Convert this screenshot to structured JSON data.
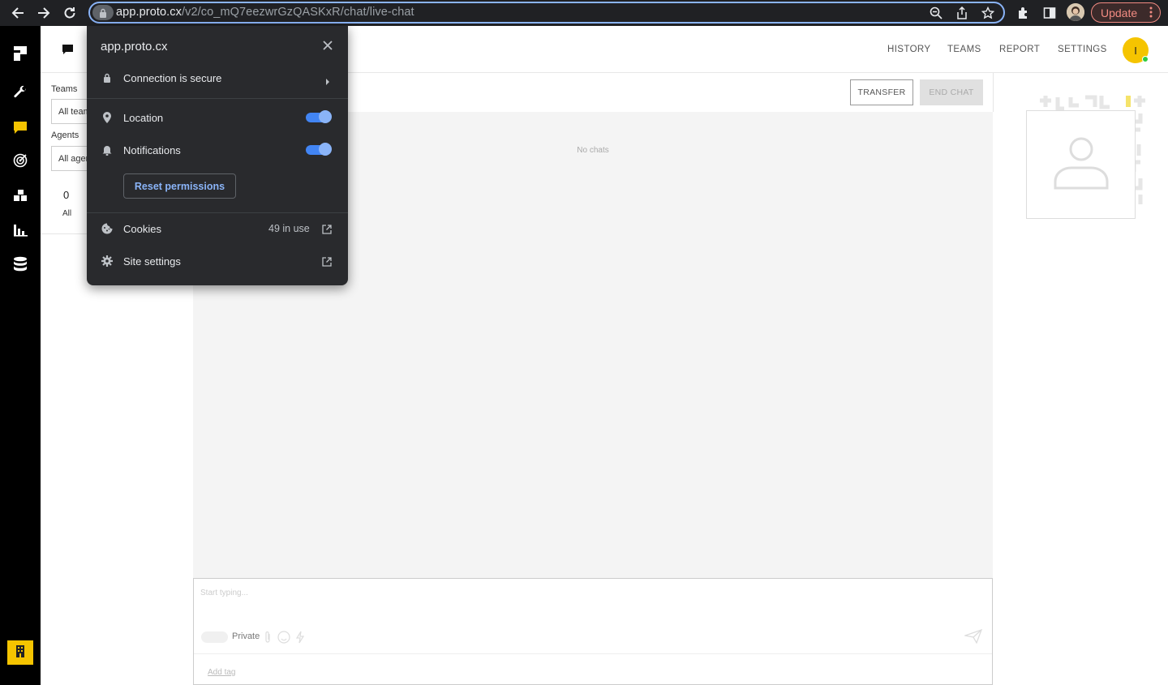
{
  "browser": {
    "url_host": "app.proto.cx",
    "url_path": "/v2/co_mQ7eezwrGzQASKxR/chat/live-chat",
    "update_label": "Update"
  },
  "nav": {
    "items": [
      "HISTORY",
      "TEAMS",
      "REPORT",
      "SETTINGS"
    ],
    "user_initial": "I"
  },
  "filters": {
    "teams_label": "Teams",
    "teams_value": "All teams",
    "agents_label": "Agents",
    "agents_value": "All agents",
    "count_value": "0",
    "count_label": "All"
  },
  "chat": {
    "transfer_label": "TRANSFER",
    "end_chat_label": "END CHAT",
    "empty_text": "No chats",
    "composer_placeholder": "Start typing...",
    "private_label": "Private",
    "add_tag_label": "Add tag"
  },
  "site_info": {
    "title": "app.proto.cx",
    "connection_label": "Connection is secure",
    "location_label": "Location",
    "notifications_label": "Notifications",
    "reset_label": "Reset permissions",
    "cookies_label": "Cookies",
    "cookies_meta": "49 in use",
    "site_settings_label": "Site settings",
    "location_enabled": true,
    "notifications_enabled": true
  },
  "colors": {
    "accent": "#f5c400",
    "chrome_focus": "#8ab4f8",
    "toggle_on": "#4285f4",
    "online": "#2ecc40"
  }
}
